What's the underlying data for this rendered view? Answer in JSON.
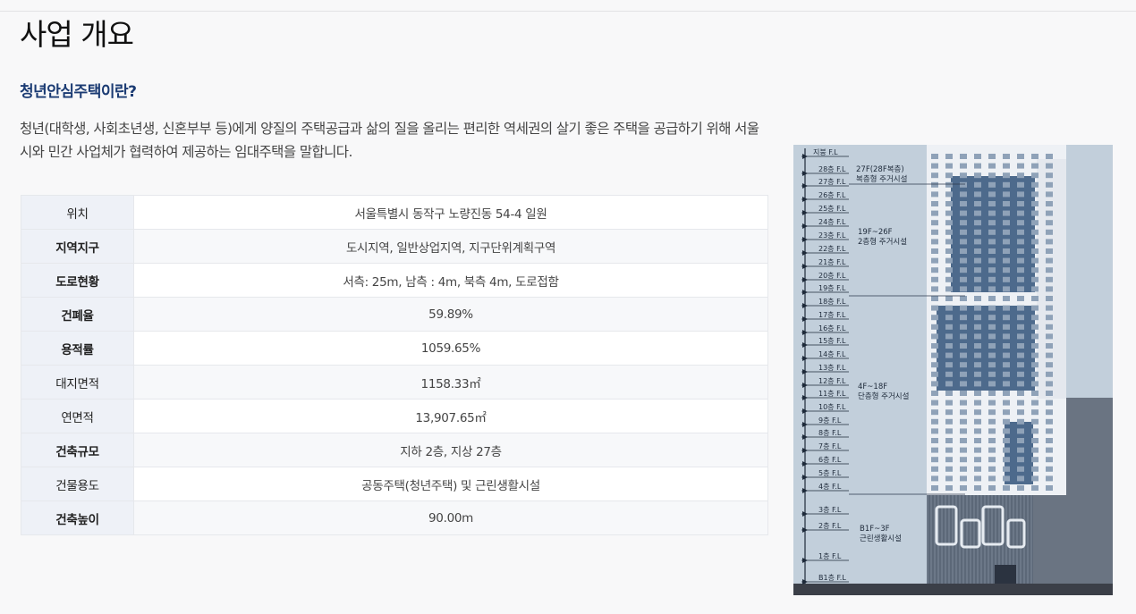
{
  "page": {
    "title": "사업 개요",
    "subtitle": "청년안심주택이란?",
    "description": "청년(대학생, 사회초년생, 신혼부부 등)에게 양질의 주택공급과 삶의 질을 올리는 편리한 역세권의 살기 좋은 주택을 공급하기 위해 서울시와 민간 사업체가 협력하여 제공하는 임대주택을 말합니다."
  },
  "overview_table": [
    {
      "label": "위치",
      "value": "서울특별시 동작구 노량진동 54-4 일원",
      "bold": false
    },
    {
      "label": "지역지구",
      "value": "도시지역, 일반상업지역, 지구단위계획구역",
      "bold": true
    },
    {
      "label": "도로현황",
      "value": "서측: 25m, 남측 : 4m, 북측 4m, 도로접함",
      "bold": true
    },
    {
      "label": "건폐율",
      "value": "59.89%",
      "bold": true
    },
    {
      "label": "용적률",
      "value": "1059.65%",
      "bold": true
    },
    {
      "label": "대지면적",
      "value": "1158.33㎡",
      "bold": false
    },
    {
      "label": "연면적",
      "value": "13,907.65㎡",
      "bold": false
    },
    {
      "label": "건축규모",
      "value": "지하 2층, 지상 27층",
      "bold": true
    },
    {
      "label": "건물용도",
      "value": "공동주택(청년주택) 및 근린생활시설",
      "bold": false
    },
    {
      "label": "건축높이",
      "value": "90.00m",
      "bold": true
    }
  ],
  "elevation": {
    "floor_labels": [
      "지붕 F.L",
      "28층 F.L",
      "27층 F.L",
      "26층 F.L",
      "25층 F.L",
      "24층 F.L",
      "23층 F.L",
      "22층 F.L",
      "21층 F.L",
      "20층 F.L",
      "19층 F.L",
      "18층 F.L",
      "17층 F.L",
      "16층 F.L",
      "15층 F.L",
      "14층 F.L",
      "13층 F.L",
      "12층 F.L",
      "11층 F.L",
      "10층 F.L",
      "9층 F.L",
      "8층 F.L",
      "7층 F.L",
      "6층 F.L",
      "5층 F.L",
      "4층 F.L",
      "3층 F.L",
      "2층 F.L",
      "1층 F.L",
      "B1층 F.L"
    ],
    "zones": [
      {
        "line1": "27F(28F복층)",
        "line2": "복층형 주거시설"
      },
      {
        "line1": "19F~26F",
        "line2": "2층형 주거시설"
      },
      {
        "line1": "4F~18F",
        "line2": "단층형 주거시설"
      },
      {
        "line1": "B1F~3F",
        "line2": "근린생활시설"
      }
    ],
    "colors": {
      "sky": "#c2cfdb",
      "facade_white": "#eef1f5",
      "glass": "#4d6a8c",
      "podium": "#5c6878",
      "tower_gray": "#6a7482"
    }
  }
}
